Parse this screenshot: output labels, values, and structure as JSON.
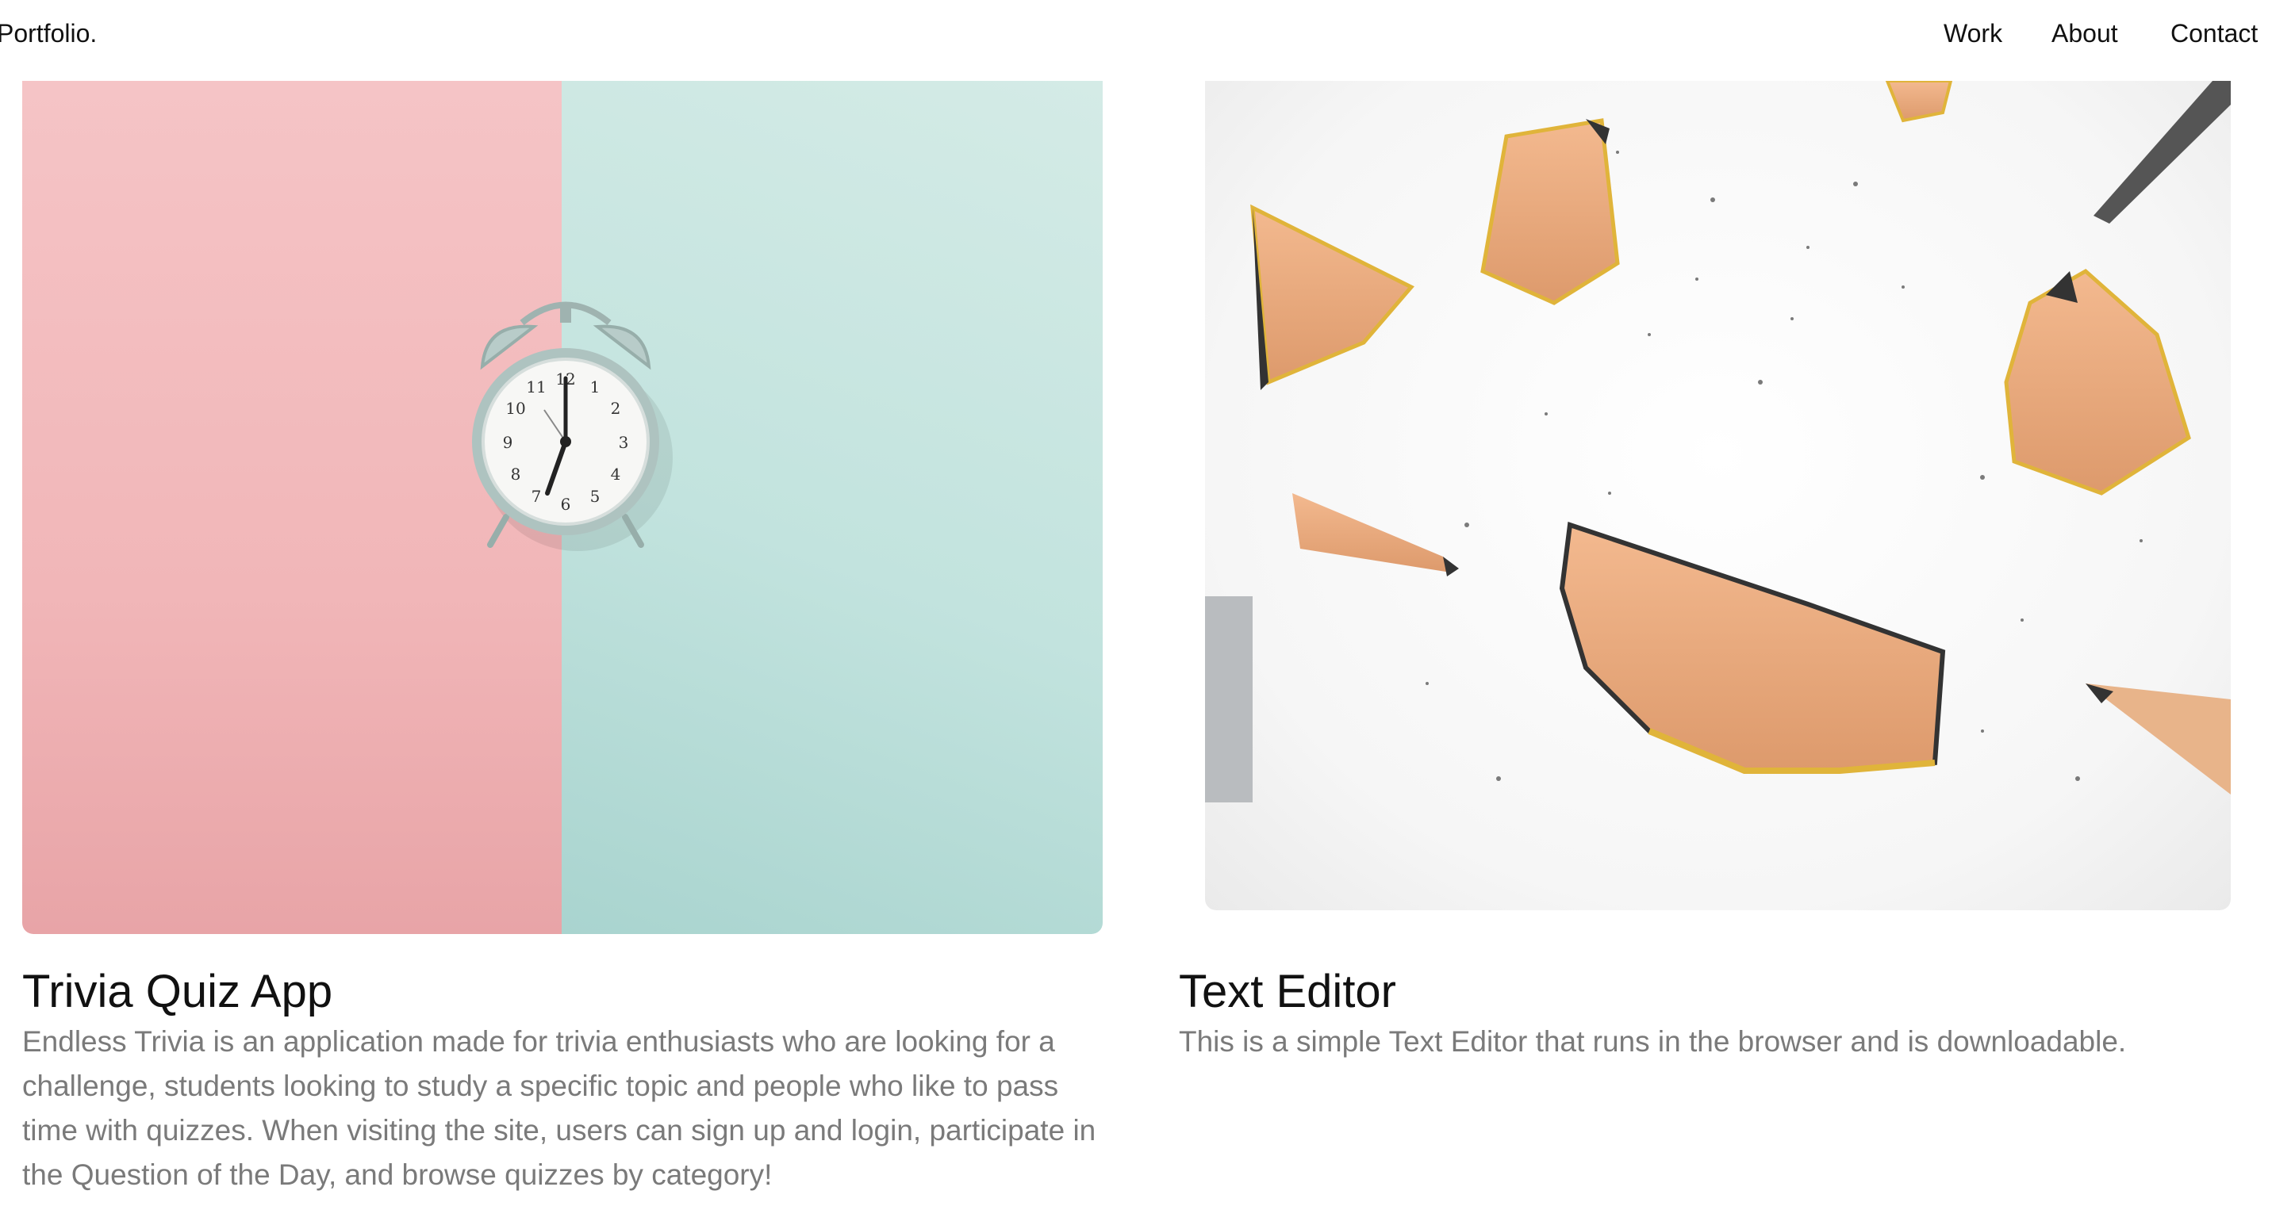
{
  "nav": {
    "brand": "Portfolio.",
    "links": [
      {
        "label": "Work"
      },
      {
        "label": "About"
      },
      {
        "label": "Contact"
      }
    ]
  },
  "projects": [
    {
      "title": "Trivia Quiz App",
      "description": "Endless Trivia is an application made for trivia enthusiasts who are looking for a challenge, students looking to study a specific topic and people who like to pass time with quizzes. When visiting the site, users can sign up and login, participate in the Question of the Day, and browse quizzes by category!",
      "image_icon": "alarm-clock-photo"
    },
    {
      "title": "Text Editor",
      "description": "This is a simple Text Editor that runs in the browser and is downloadable.",
      "image_icon": "pencil-shavings-photo"
    }
  ],
  "colors": {
    "pink": "#f5c4c6",
    "mint": "#c8e6e1",
    "title": "#111111",
    "description": "#7a7a7a"
  }
}
